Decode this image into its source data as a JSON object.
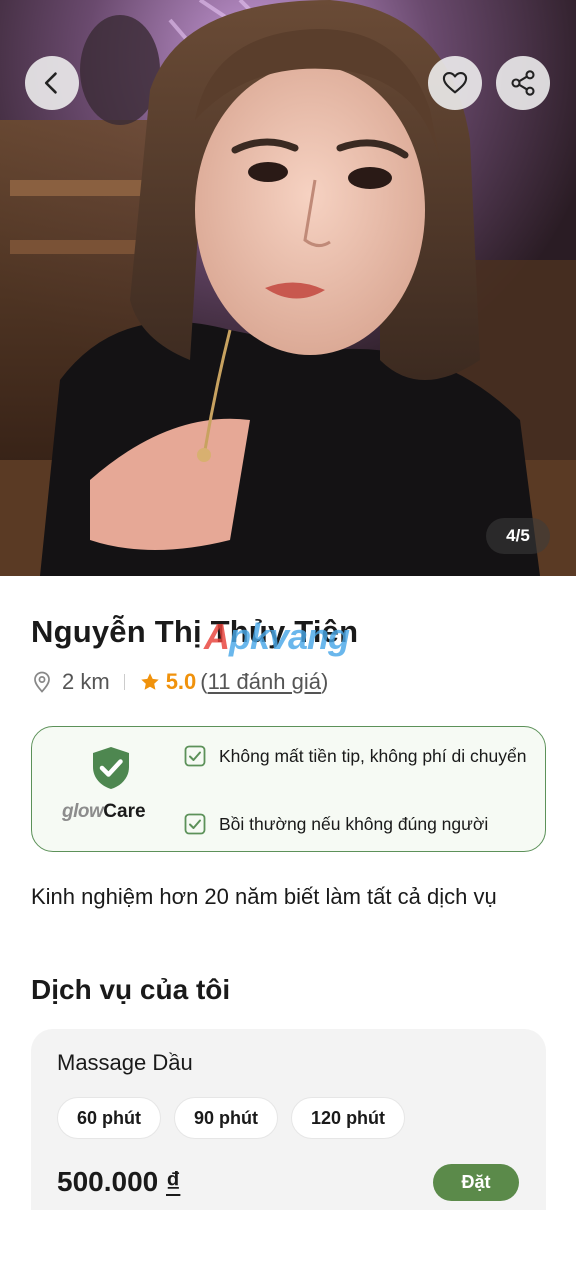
{
  "gallery": {
    "counter": "4/5"
  },
  "header": {
    "back_icon": "chevron-left-icon",
    "favorite_icon": "heart-icon",
    "share_icon": "share-icon"
  },
  "profile": {
    "name": "Nguyễn Thị Thủy Tiên",
    "watermark": {
      "a": "A",
      "rest": "pkvang"
    },
    "distance": "2 km",
    "rating": "5.0",
    "reviews_open": "(",
    "reviews_text": "11 đánh giá",
    "reviews_close": ")",
    "bio": "Kinh nghiệm hơn 20 năm biết làm tất cả dịch vụ"
  },
  "care": {
    "logo_glow": "glow",
    "logo_care": "Care",
    "items": [
      "Không mất tiền tip, không phí di chuyển",
      "Bồi thường nếu không đúng người"
    ],
    "accent_color": "#5c9159"
  },
  "services": {
    "title": "Dịch vụ của tôi",
    "items": [
      {
        "name": "Massage Dầu",
        "durations": [
          "60 phút",
          "90 phút",
          "120 phút"
        ],
        "price": "500.000",
        "currency": "₫",
        "book_label": "Đặt"
      }
    ]
  },
  "colors": {
    "rating": "#f0920c",
    "book_button": "#5b8a4a",
    "card_bg": "#f3f3f3"
  }
}
